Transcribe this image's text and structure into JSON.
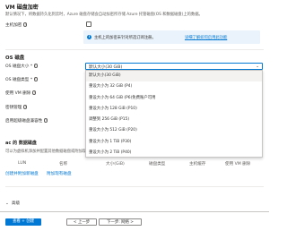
{
  "header": {
    "title": "VM 磁盘加密",
    "description": "默认情况下，将数据持久化到云时，Azure 磁盘存储会自动加密所存储 Azure 托管磁盘(OS 和数据磁盘)上的数据。"
  },
  "host_encryption": {
    "label": "主机加密"
  },
  "info_banner": {
    "text": "主机上的加密未针对所选订阅注册。",
    "link": "详细了解如何启用此功能"
  },
  "os_disk": {
    "title": "OS 磁盘",
    "size_label": "OS 磁盘大小 *",
    "size_value": "默认大小(30 GiB)",
    "type_label": "OS 磁盘类型 *",
    "delete_label": "使用 VM 删除",
    "key_mgmt_label": "密钥管理",
    "ultra_label": "启用超级磁盘兼容性"
  },
  "dropdown": {
    "options": [
      "默认大小(30 GiB)",
      "重设大小为 32 GiB (P4)",
      "重设大小为 64 GiB (P6)免费账户可用",
      "重设大小为 128 GiB (P10)",
      "调整到 256 GiB (P15)",
      "重设大小为 512 GiB (P20)",
      "重设大小为 1 TiB (P30)",
      "重设大小为 2 TiB (P40)"
    ],
    "selected_index": 0
  },
  "data_disks": {
    "title": "ac 的 数据磁盘",
    "description": "可以为虚拟机添加并配置其他数据磁盘或附加现有磁盘。",
    "columns": [
      "LUN",
      "名称",
      "大小(GiB)",
      "磁盘类型",
      "主机缓存",
      "使用 VM 删除"
    ],
    "create_link": "创建并附加新磁盘",
    "attach_link": "附加现有磁盘"
  },
  "advanced": {
    "label": "高级"
  },
  "footer": {
    "review_create": "查看 + 创建",
    "previous": "< 上一步",
    "next": "下一步: 网络 >"
  }
}
